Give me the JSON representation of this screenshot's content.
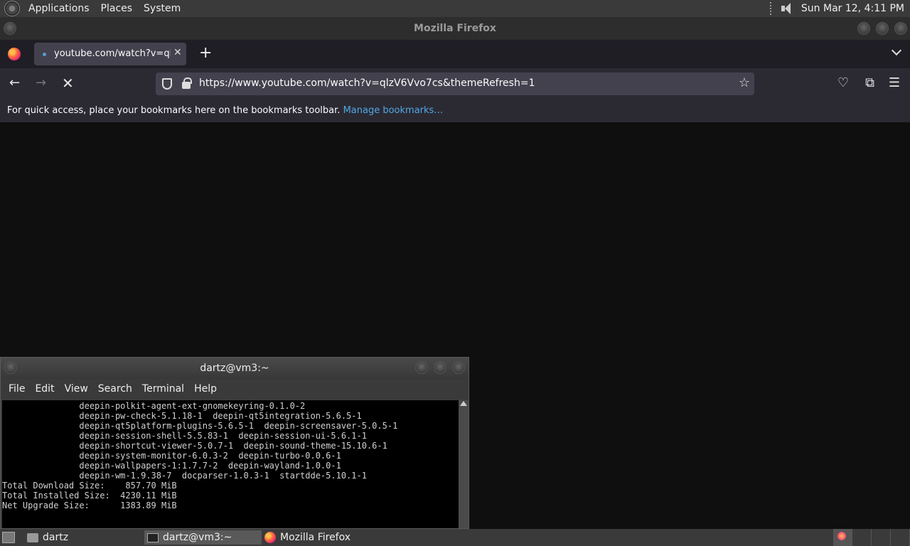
{
  "top_panel": {
    "menus": [
      "Applications",
      "Places",
      "System"
    ],
    "clock": "Sun Mar 12,  4:11 PM"
  },
  "firefox": {
    "window_title": "Mozilla Firefox",
    "tab": {
      "title": "youtube.com/watch?v=qlzV6"
    },
    "url": "https://www.youtube.com/watch?v=qlzV6Vvo7cs&themeRefresh=1",
    "bookmarks_bar": {
      "message": "For quick access, place your bookmarks here on the bookmarks toolbar.",
      "manage_link": "Manage bookmarks…"
    }
  },
  "terminal": {
    "title": "dartz@vm3:~",
    "menu": [
      "File",
      "Edit",
      "View",
      "Search",
      "Terminal",
      "Help"
    ],
    "lines": [
      "               deepin-polkit-agent-ext-gnomekeyring-0.1.0-2",
      "               deepin-pw-check-5.1.18-1  deepin-qt5integration-5.6.5-1",
      "               deepin-qt5platform-plugins-5.6.5-1  deepin-screensaver-5.0.5-1",
      "               deepin-session-shell-5.5.83-1  deepin-session-ui-5.6.1-1",
      "               deepin-shortcut-viewer-5.0.7-1  deepin-sound-theme-15.10.6-1",
      "               deepin-system-monitor-6.0.3-2  deepin-turbo-0.0.6-1",
      "               deepin-wallpapers-1:1.7.7-2  deepin-wayland-1.0.0-1",
      "               deepin-wm-1.9.38-7  docparser-1.0.3-1  startdde-5.10.1-1",
      "",
      "Total Download Size:    857.70 MiB",
      "Total Installed Size:  4230.11 MiB",
      "Net Upgrade Size:      1383.89 MiB"
    ]
  },
  "taskbar": {
    "items": [
      "dartz",
      "dartz@vm3:~",
      "Mozilla Firefox"
    ]
  }
}
